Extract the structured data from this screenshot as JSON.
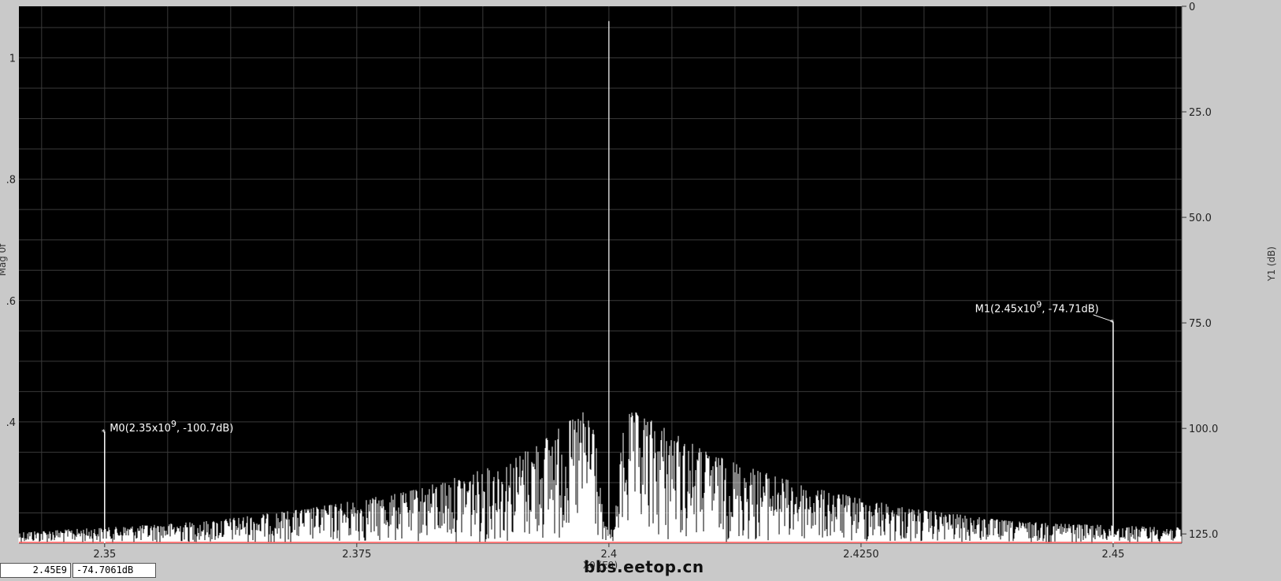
{
  "readout": {
    "x": "2.45E9",
    "y": "-74.7061dB"
  },
  "watermark": "bbs.eetop.cn",
  "colors": {
    "plot_bg": "#000000",
    "grid": "#3a3a3a",
    "trace": "#ffffff",
    "frame": "#c9c9c9",
    "zero_line": "#ff4d4d"
  },
  "chart_data": {
    "type": "line",
    "title": "",
    "xlabel": "X0 (E9)",
    "ylabel_left": "Mag 0f",
    "ylabel_right": "Y1 (dB)",
    "x_unit_scale": 1000000000.0,
    "xlim": [
      2.3415,
      2.4568
    ],
    "ylim_left": [
      0.2,
      1.085
    ],
    "ylim_right": [
      0,
      127.2
    ],
    "right_axis_inverted": true,
    "x_ticks": [
      {
        "value": 2.35,
        "label": "2.35"
      },
      {
        "value": 2.375,
        "label": "2.375"
      },
      {
        "value": 2.4,
        "label": "2.4"
      },
      {
        "value": 2.425,
        "label": "2.4250"
      },
      {
        "value": 2.45,
        "label": "2.45"
      }
    ],
    "y_left_ticks": [
      {
        "value": 0.4,
        "label": ".4"
      },
      {
        "value": 0.6,
        "label": ".6"
      },
      {
        "value": 0.8,
        "label": ".8"
      },
      {
        "value": 1.0,
        "label": "1"
      }
    ],
    "y_right_ticks": [
      {
        "value": 0,
        "label": "0"
      },
      {
        "value": 25,
        "label": "25.0"
      },
      {
        "value": 50,
        "label": "50.0"
      },
      {
        "value": 75,
        "label": "75.0"
      },
      {
        "value": 100,
        "label": "100.0"
      },
      {
        "value": 125,
        "label": "125.0"
      }
    ],
    "grid": true,
    "series": [
      {
        "name": "",
        "carrier": {
          "x": 2.4,
          "y_db": 3.5
        },
        "envelope_db": [
          [
            2.3415,
            124.5
          ],
          [
            2.35,
            123.5
          ],
          [
            2.36,
            122.0
          ],
          [
            2.37,
            119.0
          ],
          [
            2.38,
            115.0
          ],
          [
            2.39,
            108.0
          ],
          [
            2.395,
            100.0
          ],
          [
            2.3975,
            96.0
          ],
          [
            2.3985,
            96.5
          ],
          [
            2.3995,
            123.0
          ],
          [
            2.4005,
            124.0
          ],
          [
            2.4015,
            97.0
          ],
          [
            2.4025,
            96.0
          ],
          [
            2.405,
            99.0
          ],
          [
            2.41,
            106.0
          ],
          [
            2.42,
            114.0
          ],
          [
            2.43,
            119.0
          ],
          [
            2.44,
            122.0
          ],
          [
            2.45,
            123.0
          ],
          [
            2.4568,
            123.5
          ]
        ],
        "floor_db": 127.2
      }
    ],
    "markers": [
      {
        "name": "M0",
        "label": "M0(2.35x10",
        "exp": "9",
        "suffix": ", -100.7dB)",
        "x": 2.35,
        "y_db": 100.7,
        "label_anchor": [
          2.3505,
          100.7
        ]
      },
      {
        "name": "M1",
        "label": "M1(2.45x10",
        "exp": "9",
        "suffix": ", -74.71dB)",
        "x": 2.45,
        "y_db": 74.71,
        "label_anchor": [
          2.4363,
          72.5
        ]
      }
    ]
  }
}
